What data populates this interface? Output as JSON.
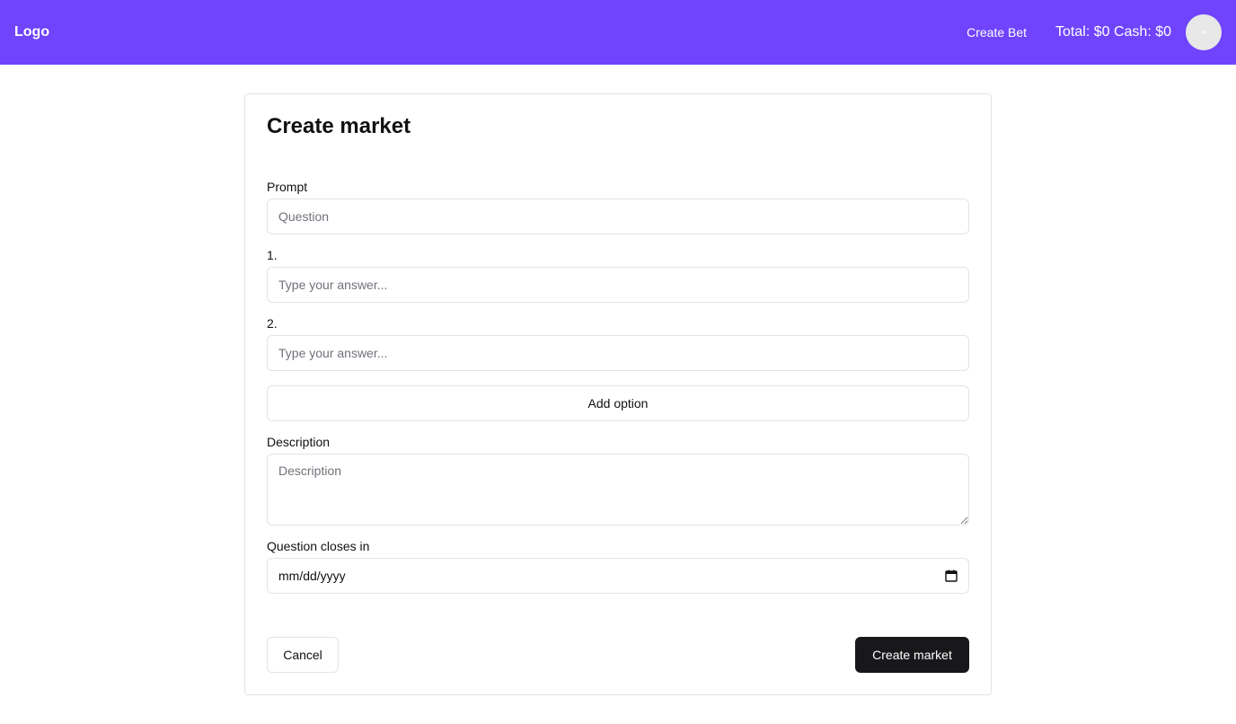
{
  "navbar": {
    "logo": "Logo",
    "create_bet": "Create Bet",
    "balance": "Total: $0 Cash: $0",
    "avatar_icon": "user-avatar"
  },
  "form": {
    "title": "Create market",
    "prompt_label": "Prompt",
    "prompt_placeholder": "Question",
    "options": [
      {
        "label": "1.",
        "placeholder": "Type your answer..."
      },
      {
        "label": "2.",
        "placeholder": "Type your answer..."
      }
    ],
    "add_option_label": "Add option",
    "description_label": "Description",
    "description_placeholder": "Description",
    "closes_label": "Question closes in",
    "date_placeholder": "mm/dd/yyyy",
    "calendar_icon": "calendar-icon",
    "cancel_label": "Cancel",
    "create_label": "Create market"
  },
  "colors": {
    "brand": "#6f44fc",
    "primary_button": "#18181b",
    "border": "#e4e4e7",
    "placeholder": "#71717a"
  }
}
